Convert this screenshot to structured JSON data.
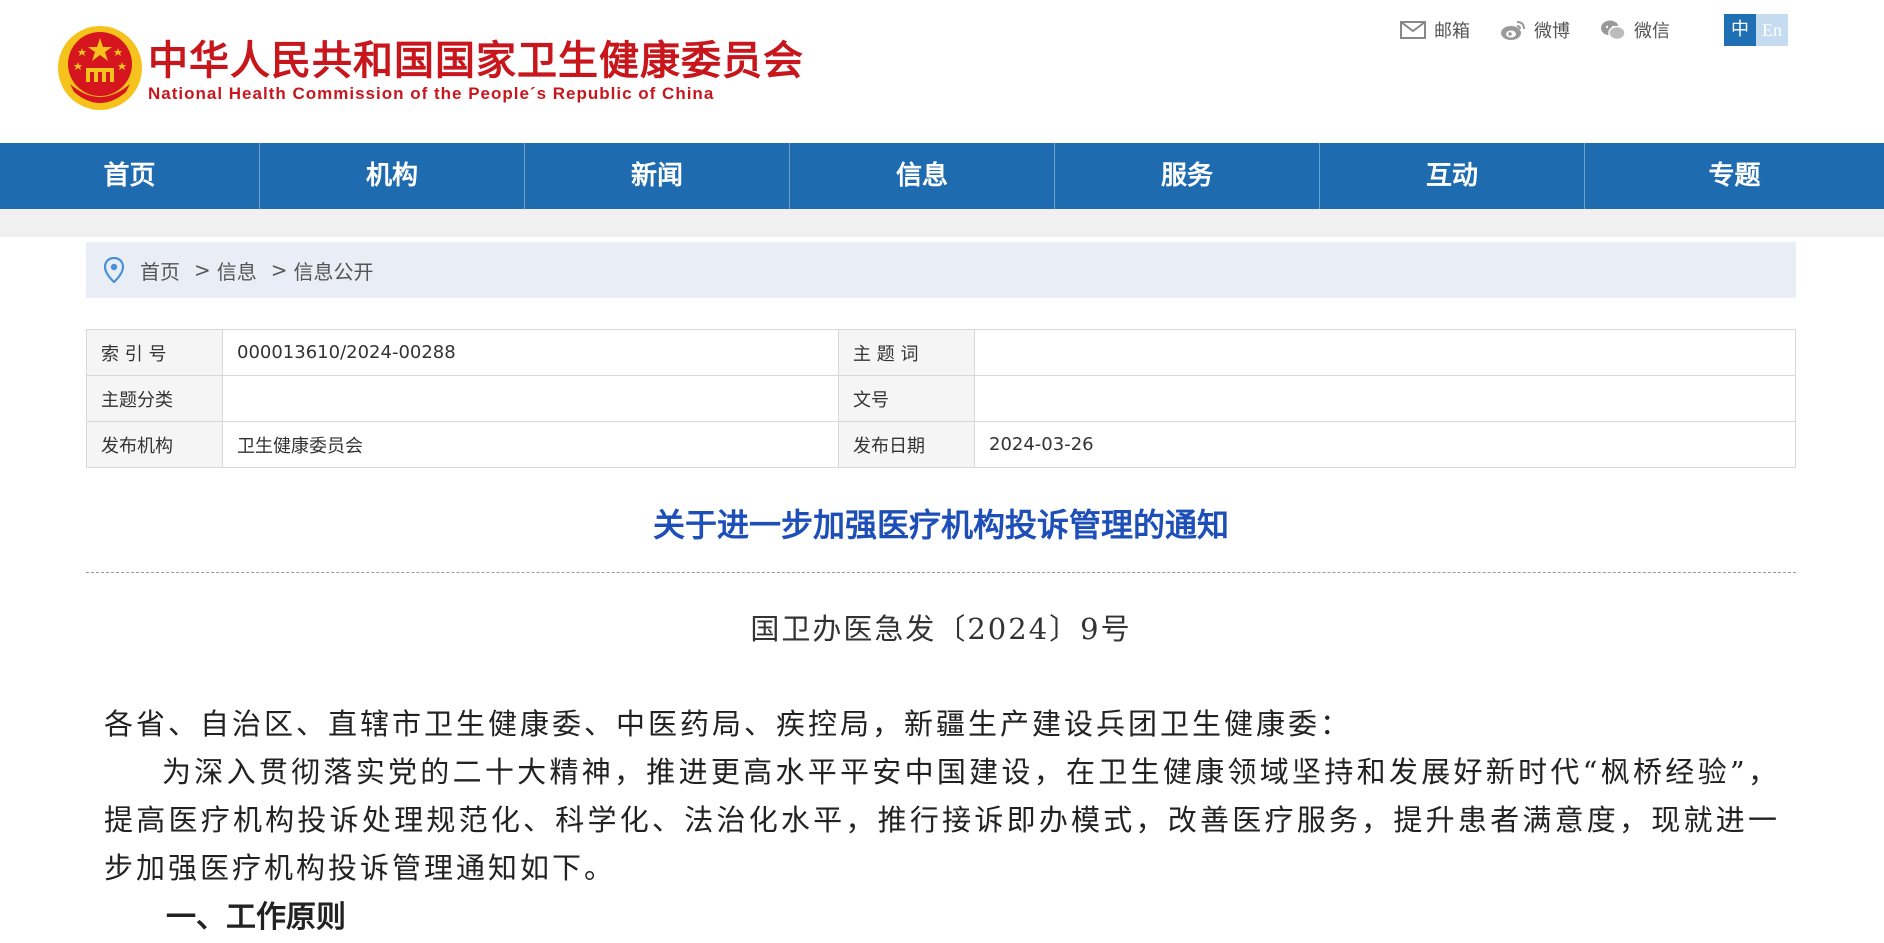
{
  "header": {
    "title_cn": "中华人民共和国国家卫生健康委员会",
    "title_en": "National Health Commission of the People´s Republic of China",
    "links": [
      {
        "label": "邮箱",
        "icon": "mail-icon"
      },
      {
        "label": "微博",
        "icon": "weibo-icon"
      },
      {
        "label": "微信",
        "icon": "wechat-icon"
      }
    ],
    "lang_cn": "中",
    "lang_en": "En"
  },
  "nav": {
    "items": [
      "首页",
      "机构",
      "新闻",
      "信息",
      "服务",
      "互动",
      "专题"
    ]
  },
  "breadcrumb": {
    "items": [
      "首页",
      "信息",
      "信息公开"
    ],
    "separator": ">"
  },
  "meta": {
    "index_label": "索 引 号",
    "index_value": "000013610/2024-00288",
    "keyword_label": "主 题 词",
    "keyword_value": "",
    "category_label": "主题分类",
    "category_value": "",
    "docno_label": "文号",
    "docno_value": "",
    "publisher_label": "发布机构",
    "publisher_value": "卫生健康委员会",
    "date_label": "发布日期",
    "date_value": "2024-03-26"
  },
  "article": {
    "title": "关于进一步加强医疗机构投诉管理的通知",
    "doc_number": "国卫办医急发〔2024〕9号",
    "addressee": "各省、自治区、直辖市卫生健康委、中医药局、疾控局，新疆生产建设兵团卫生健康委：",
    "paragraph1": "为深入贯彻落实党的二十大精神，推进更高水平平安中国建设，在卫生健康领域坚持和发展好新时代“枫桥经验”，提高医疗机构投诉处理规范化、科学化、法治化水平，推行接诉即办模式，改善医疗服务，提升患者满意度，现就进一步加强医疗机构投诉管理通知如下。",
    "section1": "一、工作原则"
  },
  "colors": {
    "brand_red": "#c8161d",
    "nav_blue": "#1e6bb0",
    "title_blue": "#1e4fb8"
  }
}
